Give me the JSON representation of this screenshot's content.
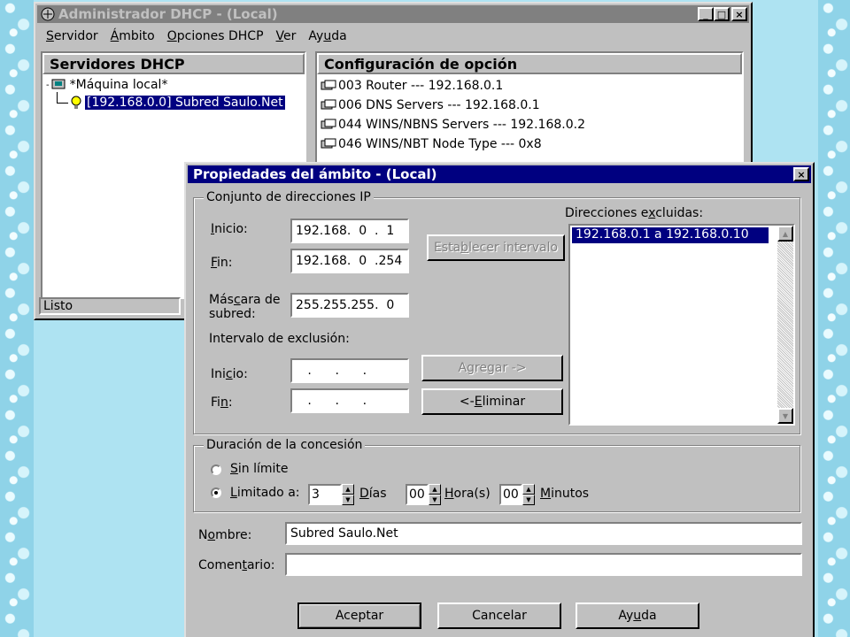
{
  "main_window": {
    "title": "Administrador DHCP - (Local)",
    "menu": [
      {
        "pre": "",
        "key": "S",
        "post": "ervidor"
      },
      {
        "pre": "",
        "key": "Á",
        "post": "mbito"
      },
      {
        "pre": "",
        "key": "O",
        "post": "pciones DHCP"
      },
      {
        "pre": "",
        "key": "V",
        "post": "er"
      },
      {
        "pre": "Ay",
        "key": "u",
        "post": "da"
      }
    ],
    "left_header": "Servidores DHCP",
    "right_header": "Configuración de opción",
    "tree": {
      "root": "*Máquina local*",
      "child": "[192.168.0.0] Subred Saulo.Net"
    },
    "options": [
      "003 Router --- 192.168.0.1",
      "006 DNS Servers --- 192.168.0.1",
      "044 WINS/NBNS Servers --- 192.168.0.2",
      "046 WINS/NBT Node Type --- 0x8"
    ],
    "status": "Listo",
    "win_buttons": [
      "_",
      "□",
      "×"
    ]
  },
  "dialog": {
    "title": "Propiedades del ámbito - (Local)",
    "close": "×",
    "ip_group": "Conjunto de direcciones IP",
    "start_label": {
      "pre": "",
      "key": "I",
      "post": "nicio:"
    },
    "end_label": {
      "pre": "",
      "key": "F",
      "post": "in:"
    },
    "start_value": "192.168.  0  .  1",
    "end_value": "192.168.  0  .254",
    "mask_label_1": {
      "pre": "Más",
      "key": "c",
      "post": "ara de"
    },
    "mask_label_2": "subred:",
    "mask_value": "255.255.255.  0",
    "set_range_button": {
      "pre": "Esta",
      "key": "b",
      "post": "lecer intervalo"
    },
    "excluded_label": {
      "pre": "Direcciones e",
      "key": "x",
      "post": "cluidas:"
    },
    "excluded_items": [
      "192.168.0.1 a 192.168.0.10"
    ],
    "exclusion_range": "Intervalo de exclusión:",
    "excl_start_label": {
      "pre": "Ini",
      "key": "c",
      "post": "io:"
    },
    "excl_end_label": {
      "pre": "Fi",
      "key": "n",
      "post": ":"
    },
    "excl_start_value": "   .      .      .",
    "excl_end_value": "   .      .      .",
    "add_button": {
      "pre": "A",
      "key": "g",
      "post": "regar ->"
    },
    "remove_button": {
      "pre": "<- ",
      "key": "E",
      "post": "liminar"
    },
    "lease_group": "Duración de la concesión",
    "unlimited": {
      "pre": "",
      "key": "S",
      "post": "in límite",
      "selected": false
    },
    "limited": {
      "pre": "",
      "key": "L",
      "post": "imitado a:",
      "selected": true
    },
    "days_value": "3",
    "days_label": {
      "pre": "",
      "key": "D",
      "post": "ías"
    },
    "hours_value": "00",
    "hours_label": {
      "pre": "",
      "key": "H",
      "post": "ora(s)"
    },
    "minutes_value": "00",
    "minutes_label": {
      "pre": "",
      "key": "M",
      "post": "inutos"
    },
    "name_label": {
      "pre": "N",
      "key": "o",
      "post": "mbre:"
    },
    "name_value": "Subred Saulo.Net",
    "comment_label": {
      "pre": "Comen",
      "key": "t",
      "post": "ario:"
    },
    "comment_value": "",
    "ok_button": "Aceptar",
    "cancel_button": "Cancelar",
    "help_button": {
      "pre": "Ay",
      "key": "u",
      "post": "da"
    }
  },
  "colors": {
    "face": "#c0c0c0",
    "active_title": "#000080",
    "inactive_title": "#808080",
    "desktop": "#aee3f2"
  }
}
